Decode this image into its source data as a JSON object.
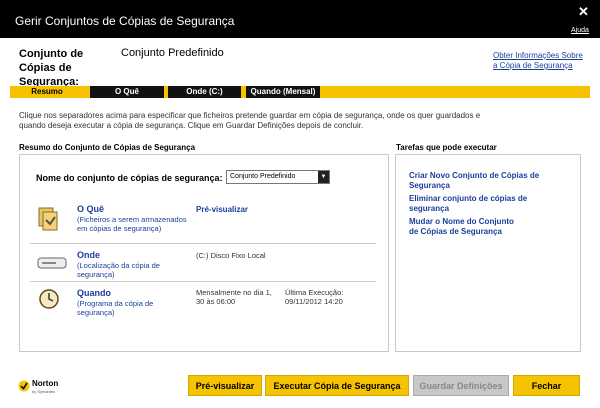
{
  "window": {
    "title": "Gerir Conjuntos de Cópias de Segurança",
    "close_glyph": "✕",
    "help": "Ajuda"
  },
  "header": {
    "label": "Conjunto de Cópias de Segurança:",
    "value": "Conjunto Predefinido",
    "link": "Obter Informações Sobre a Cópia de Segurança"
  },
  "tabs": [
    {
      "label": "Resumo",
      "active": true
    },
    {
      "label": "O Quê",
      "active": false
    },
    {
      "label": "Onde (C:)",
      "active": false
    },
    {
      "label": "Quando (Mensal)",
      "active": false
    }
  ],
  "description": "Clique nos separadores acima para especificar que ficheiros pretende guardar em cópia de segurança, onde os quer guardados e quando deseja executar a cópia de segurança. Clique em Guardar Definições depois de concluir.",
  "summary": {
    "title": "Resumo do Conjunto de Cópias de Segurança",
    "name_label": "Nome do conjunto de cópias de segurança:",
    "name_value": "Conjunto Predefinido",
    "rows": [
      {
        "title": "O Quê",
        "sub": "(Ficheiros a serem armazenados em cópias de segurança)",
        "link": "Pré-visualizar"
      },
      {
        "title": "Onde",
        "sub": "(Localização da cópia de segurança)",
        "text": "(C:) Disco Fixo Local"
      },
      {
        "title": "Quando",
        "sub": "(Programa da cópia de segurança)",
        "text": "Mensalmente no dia 1, 30 às 06:00",
        "last_label": "Última Execução:",
        "last_value": "09/11/2012 14:20"
      }
    ]
  },
  "tasks": {
    "title": "Tarefas que pode executar",
    "items": [
      "Criar Novo Conjunto de Cópias de Segurança",
      "Eliminar conjunto de cópias de segurança",
      "Mudar o Nome do Conjunto de Cópias de Segurança"
    ]
  },
  "footer": {
    "logo": "Norton",
    "logo_sub": "by Symantec",
    "buttons": [
      {
        "label": "Pré-visualizar",
        "enabled": true
      },
      {
        "label": "Executar Cópia de Segurança",
        "enabled": true
      },
      {
        "label": "Guardar Definições",
        "enabled": false
      },
      {
        "label": "Fechar",
        "enabled": true
      }
    ]
  },
  "colors": {
    "accent": "#f5c300",
    "link": "#1a3f9a",
    "titlebar": "#000000"
  }
}
